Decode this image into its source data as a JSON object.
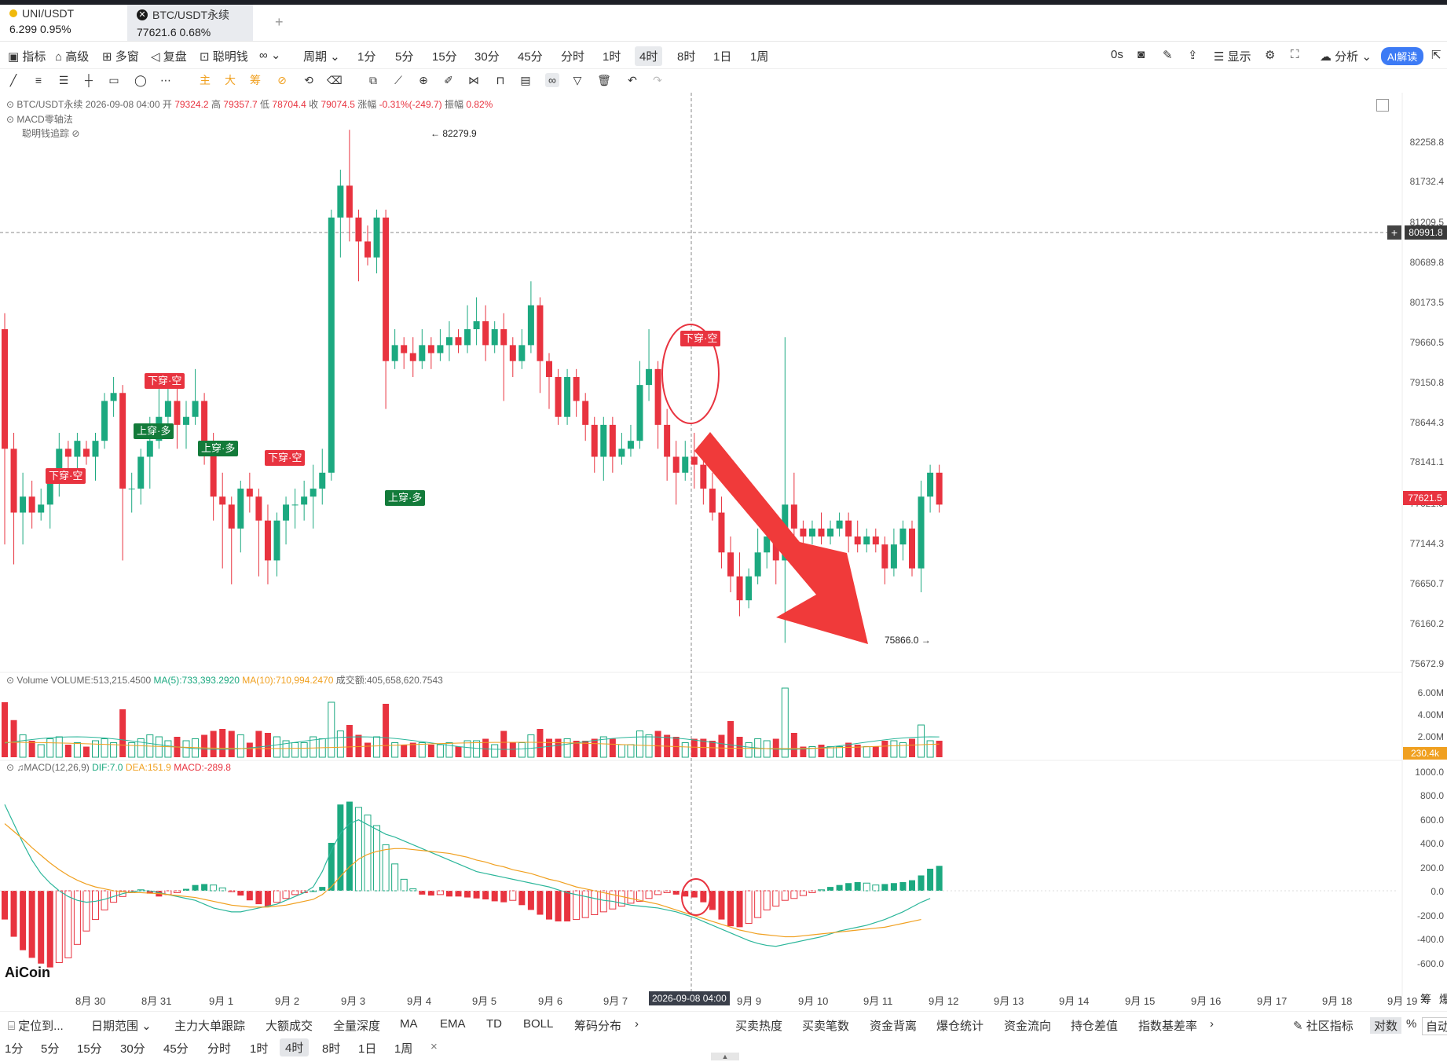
{
  "tabs": [
    {
      "name": "UNI/USDT",
      "price": "6.299",
      "change": "0.95%"
    },
    {
      "name": "BTC/USDT永续",
      "price": "77621.6",
      "change": "0.68%"
    }
  ],
  "toolbar": {
    "items": [
      "指标",
      "高级",
      "多窗",
      "复盘",
      "聪明钱",
      "周期"
    ],
    "periods": [
      "1分",
      "5分",
      "15分",
      "30分",
      "45分",
      "分时",
      "1时",
      "4时",
      "8时",
      "1日",
      "1周"
    ],
    "selected_period": "4时",
    "right_items": [
      "0s",
      "显示",
      "分析",
      "AI解读"
    ]
  },
  "legend": {
    "symbol": "BTC/USDT永续",
    "datetime": "2026-09-08 04:00",
    "open_label": "开",
    "open": "79324.2",
    "high_label": "高",
    "high": "79357.7",
    "low_label": "低",
    "low": "78704.4",
    "close_label": "收",
    "close": "79074.5",
    "chg_label": "涨幅",
    "chg": "-0.31%(-249.7)",
    "amp_label": "振幅",
    "amp": "0.82%",
    "macd_zero": "MACD零轴法",
    "smart": "聪明钱追踪"
  },
  "price_axis": [
    "82258.8",
    "81732.4",
    "81209.5",
    "80689.8",
    "80173.5",
    "79660.5",
    "79150.8",
    "78644.3",
    "78141.1",
    "77621.5",
    "77144.3",
    "76650.7",
    "76160.2",
    "75672.9"
  ],
  "crosshair_price": "80991.8",
  "last_price": "77621.5",
  "annotations": {
    "high": "← 82279.9",
    "low": "75866.0 →"
  },
  "signals": [
    {
      "text": "下穿·空",
      "type": "dn"
    },
    {
      "text": "下穿·空",
      "type": "dn"
    },
    {
      "text": "上穿·多",
      "type": "up"
    },
    {
      "text": "上穿·多",
      "type": "up"
    },
    {
      "text": "下穿·空",
      "type": "dn"
    },
    {
      "text": "上穿·多",
      "type": "up"
    },
    {
      "text": "下穿·空",
      "type": "dn"
    }
  ],
  "volume_legend": {
    "title": "Volume",
    "volume": "VOLUME:513,215.4500",
    "ma5": "MA(5):733,393.2920",
    "ma10": "MA(10):710,994.2470",
    "turnover": "成交额:405,658,620.7543"
  },
  "volume_axis": [
    "6.00M",
    "4.00M",
    "2.00M"
  ],
  "volume_last": "230.4k",
  "macd_legend": {
    "title": "MACD(12,26,9)",
    "dif": "DIF:7.0",
    "dea": "DEA:151.9",
    "macd": "MACD:-289.8"
  },
  "macd_axis": [
    "1000.0",
    "800.0",
    "600.0",
    "400.0",
    "200.0",
    "0.0",
    "-200.0",
    "-400.0",
    "-600.0"
  ],
  "x_axis": [
    "8月 30",
    "8月 31",
    "9月 1",
    "9月 2",
    "9月 3",
    "9月 4",
    "9月 5",
    "9月 6",
    "9月 7",
    "9月 9",
    "9月 10",
    "9月 11",
    "9月 12",
    "9月 13",
    "9月 14",
    "9月 15",
    "9月 16",
    "9月 17",
    "9月 18",
    "9月 19"
  ],
  "x_crosshair": "2026-09-08 04:00",
  "x_right_extra": [
    "筹",
    "爆"
  ],
  "watermark": "AiCoin",
  "bottom_tools": [
    "定位到...",
    "日期范围",
    "主力大单跟踪",
    "大额成交",
    "全量深度",
    "MA",
    "EMA",
    "TD",
    "BOLL",
    "筹码分布",
    "买卖热度",
    "买卖笔数",
    "资金背离",
    "爆仓统计",
    "资金流向",
    "持仓差值",
    "指数基差率",
    "社区指标",
    "对数",
    "%",
    "自动"
  ],
  "bottom_periods": [
    "1分",
    "5分",
    "15分",
    "30分",
    "45分",
    "分时",
    "1时",
    "4时",
    "8时",
    "1日",
    "1周"
  ],
  "bottom_selected": "4时",
  "colors": {
    "up": "#1ca980",
    "down": "#e8333f",
    "ma5": "#2bb69a",
    "ma10": "#f0a020"
  }
}
